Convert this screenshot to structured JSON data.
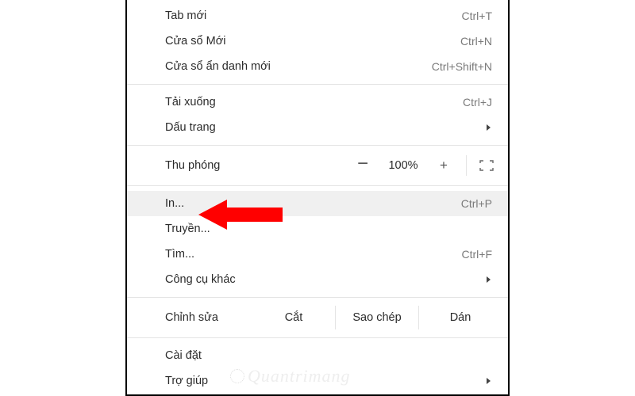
{
  "items": {
    "newTab": {
      "label": "Tab mới",
      "shortcut": "Ctrl+T"
    },
    "newWindow": {
      "label": "Cửa sổ Mới",
      "shortcut": "Ctrl+N"
    },
    "incognito": {
      "label": "Cửa sổ ẩn danh mới",
      "shortcut": "Ctrl+Shift+N"
    },
    "downloads": {
      "label": "Tải xuống",
      "shortcut": "Ctrl+J"
    },
    "bookmarks": {
      "label": "Dấu trang"
    },
    "zoom": {
      "label": "Thu phóng",
      "value": "100%"
    },
    "print": {
      "label": "In...",
      "shortcut": "Ctrl+P"
    },
    "cast": {
      "label": "Truyền..."
    },
    "find": {
      "label": "Tìm...",
      "shortcut": "Ctrl+F"
    },
    "moreTools": {
      "label": "Công cụ khác"
    },
    "edit": {
      "label": "Chỉnh sửa",
      "cut": "Cắt",
      "copy": "Sao chép",
      "paste": "Dán"
    },
    "settings": {
      "label": "Cài đặt"
    },
    "help": {
      "label": "Trợ giúp"
    }
  }
}
